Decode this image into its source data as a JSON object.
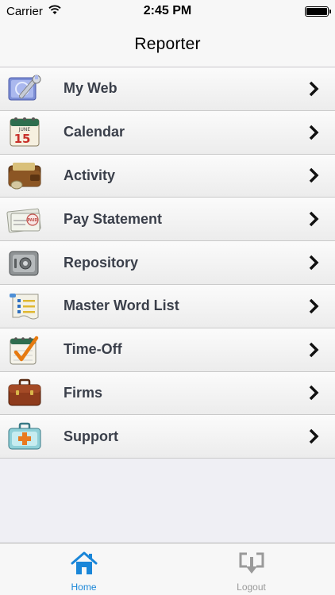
{
  "status_bar": {
    "carrier": "Carrier",
    "time": "2:45 PM",
    "wifi_icon": "wifi-icon",
    "battery_icon": "battery-icon"
  },
  "nav": {
    "title": "Reporter"
  },
  "menu": {
    "items": [
      {
        "label": "My Web",
        "icon": "tools-icon"
      },
      {
        "label": "Calendar",
        "icon": "calendar-icon"
      },
      {
        "label": "Activity",
        "icon": "wallet-icon"
      },
      {
        "label": "Pay Statement",
        "icon": "paid-envelope-icon"
      },
      {
        "label": "Repository",
        "icon": "safe-icon"
      },
      {
        "label": "Master Word List",
        "icon": "list-icon"
      },
      {
        "label": "Time-Off",
        "icon": "checklist-icon"
      },
      {
        "label": "Firms",
        "icon": "briefcase-icon"
      },
      {
        "label": "Support",
        "icon": "first-aid-icon"
      }
    ],
    "chevron_icon": "chevron-right-icon",
    "calendar_month": "JUNE",
    "calendar_day": "15",
    "envelope_stamp": "PAID"
  },
  "tab_bar": {
    "home_label": "Home",
    "logout_label": "Logout",
    "active_color": "#1a86d8",
    "inactive_color": "#9a9a9a"
  }
}
